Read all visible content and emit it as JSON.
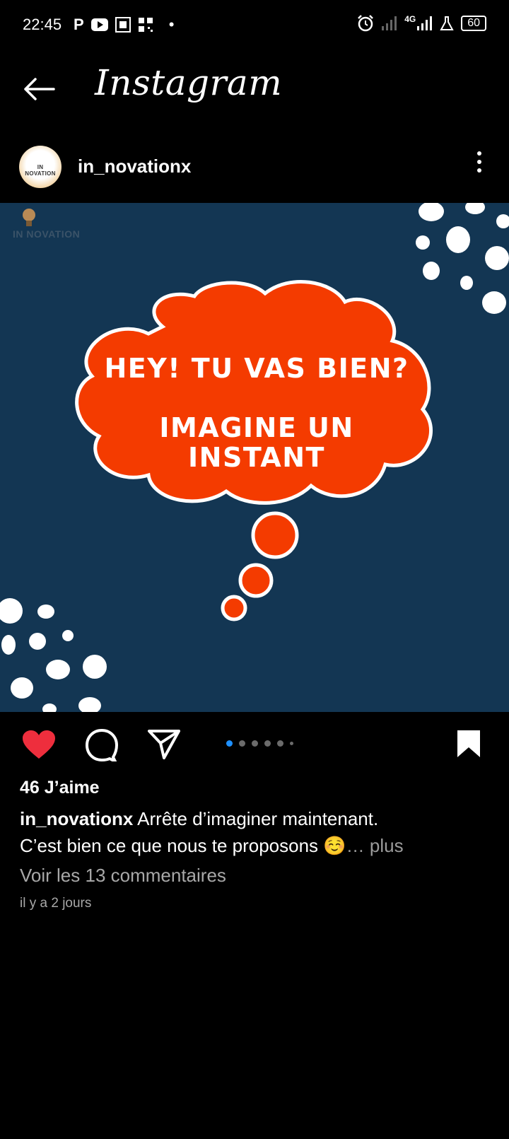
{
  "status": {
    "time": "22:45",
    "network": "4G",
    "battery": "60"
  },
  "header": {
    "title": "Instagram"
  },
  "post": {
    "username": "in_novationx",
    "avatar_text": "IN NOVATION",
    "watermark": "IN NOVATION",
    "image_line1": "HEY! TU VAS BIEN?",
    "image_line2": "IMAGINE UN",
    "image_line3": "INSTANT",
    "likes": "46 J’aime",
    "caption_user": "in_novationx",
    "caption_text": "Arrête d’imaginer maintenant.",
    "caption_text2": "C’est bien ce que nous te proposons ☺️",
    "caption_more_ellipsis": "…",
    "caption_more": "plus",
    "comments_link": "Voir les 13 commentaires",
    "time_ago": "il y a 2 jours"
  },
  "colors": {
    "like_red": "#ee2e3d",
    "image_bg": "#133653",
    "cloud_orange": "#f43b00",
    "active_dot": "#1e90ff"
  }
}
